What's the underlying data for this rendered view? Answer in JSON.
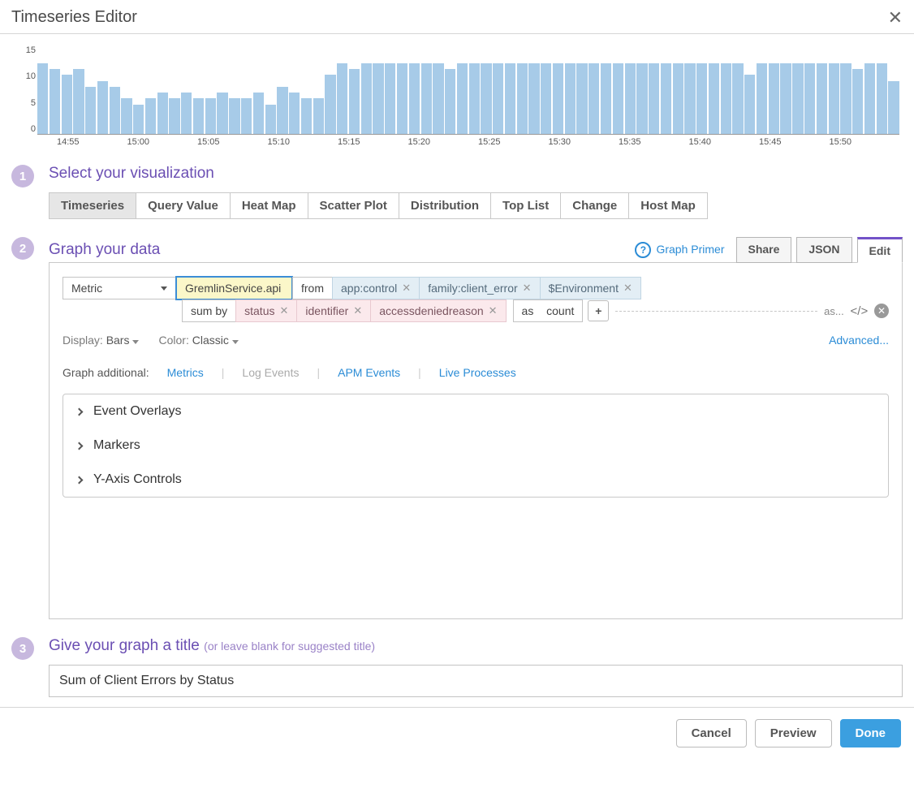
{
  "header": {
    "title": "Timeseries Editor"
  },
  "chart_data": {
    "type": "bar",
    "y_ticks": [
      15,
      10,
      5,
      0
    ],
    "x_ticks": [
      "14:55",
      "15:00",
      "15:05",
      "15:10",
      "15:15",
      "15:20",
      "15:25",
      "15:30",
      "15:35",
      "15:40",
      "15:45",
      "15:50"
    ],
    "ylim": [
      0,
      15
    ],
    "values": [
      12,
      11,
      10,
      11,
      8,
      9,
      8,
      6,
      5,
      6,
      7,
      6,
      7,
      6,
      6,
      7,
      6,
      6,
      7,
      5,
      8,
      7,
      6,
      6,
      10,
      12,
      11,
      12,
      12,
      12,
      12,
      12,
      12,
      12,
      11,
      12,
      12,
      12,
      12,
      12,
      12,
      12,
      12,
      12,
      12,
      12,
      12,
      12,
      12,
      12,
      12,
      12,
      12,
      12,
      12,
      12,
      12,
      12,
      12,
      10,
      12,
      12,
      12,
      12,
      12,
      12,
      12,
      12,
      11,
      12,
      12,
      9
    ]
  },
  "step1": {
    "title": "Select your visualization",
    "tabs": [
      "Timeseries",
      "Query Value",
      "Heat Map",
      "Scatter Plot",
      "Distribution",
      "Top List",
      "Change",
      "Host Map"
    ],
    "active": "Timeseries"
  },
  "step2": {
    "title": "Graph your data",
    "primer": "Graph Primer",
    "subtabs": [
      "Share",
      "JSON",
      "Edit"
    ],
    "active_sub": "Edit",
    "source": "Metric",
    "metric": "GremlinService.api",
    "from_label": "from",
    "from_tags": [
      "app:control",
      "family:client_error",
      "$Environment"
    ],
    "sumby_label": "sum by",
    "sumby_tags": [
      "status",
      "identifier",
      "accessdeniedreason"
    ],
    "as_label": "as",
    "as_value": "count",
    "alias_label": "as...",
    "display_label": "Display:",
    "display_value": "Bars",
    "color_label": "Color:",
    "color_value": "Classic",
    "advanced": "Advanced...",
    "addl_label": "Graph additional:",
    "addl_items": [
      "Metrics",
      "Log Events",
      "APM Events",
      "Live Processes"
    ],
    "accordions": [
      "Event Overlays",
      "Markers",
      "Y-Axis Controls"
    ]
  },
  "step3": {
    "title": "Give your graph a title",
    "hint": "(or leave blank for suggested title)",
    "value": "Sum of Client Errors by Status"
  },
  "footer": {
    "cancel": "Cancel",
    "preview": "Preview",
    "done": "Done"
  }
}
